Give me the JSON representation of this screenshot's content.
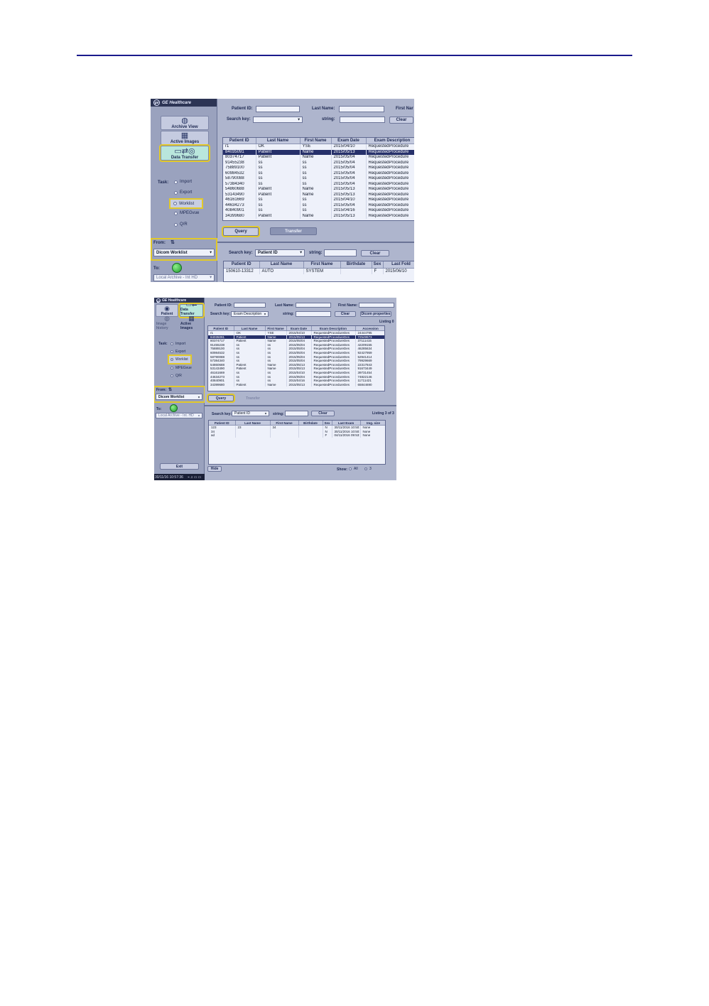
{
  "shot1": {
    "brand": "GE Healthcare",
    "nav": [
      {
        "label": "Archive View",
        "icon": "archive-view-icon"
      },
      {
        "label": "Active Images",
        "icon": "active-images-icon"
      },
      {
        "label": "Data Transfer",
        "icon": "data-transfer-icon"
      }
    ],
    "task_label": "Task:",
    "tasks": [
      "Import",
      "Export",
      "Worklist",
      "MPEGvue",
      "Q/R"
    ],
    "selected_task": "Worklist",
    "from_label": "From:",
    "from_value": "Dicom Worklist",
    "to_label": "To:",
    "to_value": "Local Archive - Int HD",
    "top_labels": {
      "patient_id": "Patient ID:",
      "last_name": "Last Name:",
      "first_name": "First Nar",
      "search_key": "Search key:",
      "string": "string:",
      "clear": "Clear"
    },
    "columns": [
      "Patient ID",
      "Last Name",
      "First Name",
      "Exam Date",
      "Exam Description"
    ],
    "rows": [
      [
        "r1",
        "OK",
        "YSE",
        "2015/04/10",
        "RequestedProcedure"
      ],
      [
        "84035091",
        "Patient",
        "Name",
        "2015/05/13",
        "RequestedProcedure"
      ],
      [
        "80374717",
        "Patient",
        "Name",
        "2015/05/04",
        "RequestedProcedure"
      ],
      [
        "91455238",
        "ss",
        "ss",
        "2015/05/04",
        "RequestedProcedure"
      ],
      [
        "75889100",
        "ss",
        "ss",
        "2015/05/04",
        "RequestedProcedure"
      ],
      [
        "60984532",
        "ss",
        "ss",
        "2015/05/04",
        "RequestedProcedure"
      ],
      [
        "58790088",
        "ss",
        "ss",
        "2015/05/04",
        "RequestedProcedure"
      ],
      [
        "57384340",
        "ss",
        "ss",
        "2015/05/04",
        "RequestedProcedure"
      ],
      [
        "54860688",
        "Patient",
        "Name",
        "2015/05/13",
        "RequestedProcedure"
      ],
      [
        "53143490",
        "Patient",
        "Name",
        "2015/05/13",
        "RequestedProcedure"
      ],
      [
        "46161669",
        "ss",
        "ss",
        "2015/04/10",
        "RequestedProcedure"
      ],
      [
        "44634273",
        "ss",
        "ss",
        "2015/05/04",
        "RequestedProcedure"
      ],
      [
        "40840901",
        "ss",
        "ss",
        "2015/04/16",
        "RequestedProcedure"
      ],
      [
        "34399680",
        "Patient",
        "Name",
        "2015/05/13",
        "RequestedProcedure"
      ]
    ],
    "selected_row": 1,
    "query": "Query",
    "transfer": "Transfer",
    "bottom": {
      "search_key": "Search key:",
      "search_value": "Patient ID",
      "string": "string:",
      "clear": "Clear",
      "columns": [
        "Patient ID",
        "Last Name",
        "First Name",
        "Birthdate",
        "Sex",
        "Last Fold"
      ],
      "rows": [
        [
          "150610-13312",
          "AUTO",
          "SYSTEM",
          "",
          "F",
          "2015/06/10"
        ]
      ]
    }
  },
  "shot2": {
    "brand": "GE Healthcare",
    "nav": [
      {
        "label": "Patient",
        "icon": "patient-icon"
      },
      {
        "label": "Data Transfer",
        "icon": "data-transfer-icon"
      },
      {
        "label": "Image history",
        "icon": "image-history-icon"
      },
      {
        "label": "Active Images",
        "icon": "active-images-icon"
      }
    ],
    "task_label": "Task:",
    "tasks": [
      "Import",
      "Export",
      "Worklist",
      "MPEGvue",
      "Q/R"
    ],
    "selected_task": "Worklist",
    "from_label": "From:",
    "from_value": "Dicom Worklist",
    "to_label": "To:",
    "to_value": "Local Archive - Int. HD",
    "exit": "Exit",
    "status_time": "30/11/16 10:57:36",
    "top_labels": {
      "patient_id": "Patient ID:",
      "last_name": "Last Name:",
      "first_name": "First Name:",
      "search_key": "Search key:",
      "search_value": "Exam Description",
      "string": "string:",
      "clear": "Clear",
      "dicom_properties": "Dicom properties",
      "listing": "Listing 0"
    },
    "columns": [
      "Patient ID",
      "Last Name",
      "First Name",
      "Exam Date",
      "Exam Description",
      "Accession"
    ],
    "rows": [
      [
        "r1",
        "OK",
        "YSE",
        "2015/04/10",
        "RequestedProcedureDes",
        "24444795"
      ],
      [
        "84035091",
        "Patient",
        "Name",
        "2015/05/13",
        "RequestedProcedureDes",
        "72549573"
      ],
      [
        "80374717",
        "Patient",
        "Name",
        "2015/05/04",
        "RequestedProcedureDes",
        "37111415"
      ],
      [
        "91455238",
        "ss",
        "ss",
        "2015/05/04",
        "RequestedProcedureDes",
        "42209155"
      ],
      [
        "75889100",
        "ss",
        "ss",
        "2015/05/04",
        "RequestedProcedureDes",
        "46285634"
      ],
      [
        "60984532",
        "ss",
        "ss",
        "2015/05/04",
        "RequestedProcedureDes",
        "92427959"
      ],
      [
        "58790088",
        "ss",
        "ss",
        "2015/05/04",
        "RequestedProcedureDes",
        "52941414"
      ],
      [
        "57384340",
        "ss",
        "ss",
        "2015/05/04",
        "RequestedProcedureDes",
        "79929669"
      ],
      [
        "54860688",
        "Patient",
        "Name",
        "2015/05/13",
        "RequestedProcedureDes",
        "22317843"
      ],
      [
        "53143490",
        "Patient",
        "Name",
        "2015/05/13",
        "RequestedProcedureDes",
        "91673449"
      ],
      [
        "46161669",
        "ss",
        "ss",
        "2015/04/10",
        "RequestedProcedureDes",
        "39731454"
      ],
      [
        "44634273",
        "ss",
        "ss",
        "2015/05/04",
        "RequestedProcedureDes",
        "74822146"
      ],
      [
        "40840901",
        "ss",
        "ss",
        "2015/04/16",
        "RequestedProcedureDes",
        "11711421"
      ],
      [
        "34399680",
        "Patient",
        "Name",
        "2015/05/13",
        "RequestedProcedureDes",
        "65844690"
      ]
    ],
    "selected_row": 1,
    "query": "Query",
    "transfer": "Transfer",
    "bottom": {
      "search_key": "Search key:",
      "search_value": "Patient ID",
      "string": "string:",
      "clear": "Clear",
      "listing": "Listing 3 of 3",
      "columns": [
        "Patient ID",
        "Last Name",
        "First Name",
        "Birthdate",
        "Sex",
        "Last Exam",
        "Img. size"
      ],
      "rows": [
        [
          "123",
          "23",
          "34",
          "",
          "N",
          "30/11/2016 10:50:",
          "None"
        ],
        [
          "34",
          "",
          "",
          "",
          "N",
          "30/11/2016 10:50:",
          "None"
        ],
        [
          "ad",
          "",
          "",
          "",
          "F",
          "04/11/2016 09:53:",
          "None"
        ]
      ],
      "hide": "Hide",
      "show": "Show:",
      "show_all": "All",
      "show_count": "3"
    }
  },
  "colors": {
    "rule": "#1a1a8c",
    "highlight": "#e2c92a",
    "selected_row": "#26306a",
    "panel": "#aeb5cd"
  }
}
